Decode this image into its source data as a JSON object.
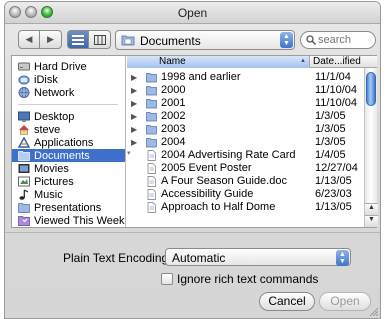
{
  "window": {
    "title": "Open"
  },
  "toolbar": {
    "back_label": "◀",
    "forward_label": "▶",
    "path": "Documents",
    "search_placeholder": "search"
  },
  "sidebar": {
    "devices": [
      {
        "label": "Hard Drive",
        "icon": "hard-drive-icon"
      },
      {
        "label": "iDisk",
        "icon": "idisk-icon"
      },
      {
        "label": "Network",
        "icon": "network-icon"
      }
    ],
    "places": [
      {
        "label": "Desktop",
        "icon": "desktop-icon"
      },
      {
        "label": "steve",
        "icon": "home-icon"
      },
      {
        "label": "Applications",
        "icon": "applications-icon"
      },
      {
        "label": "Documents",
        "icon": "documents-folder-icon",
        "selected": true
      },
      {
        "label": "Movies",
        "icon": "movies-icon"
      },
      {
        "label": "Pictures",
        "icon": "pictures-icon"
      },
      {
        "label": "Music",
        "icon": "music-icon"
      },
      {
        "label": "Presentations",
        "icon": "folder-icon"
      },
      {
        "label": "Viewed This Week",
        "icon": "smart-folder-icon"
      }
    ]
  },
  "file_list": {
    "columns": {
      "name": "Name",
      "date": "Date...ified"
    },
    "rows": [
      {
        "name": "1998 and earlier",
        "date": "11/1/04",
        "type": "folder"
      },
      {
        "name": "2000",
        "date": "11/10/04",
        "type": "folder"
      },
      {
        "name": "2001",
        "date": "11/10/04",
        "type": "folder"
      },
      {
        "name": "2002",
        "date": "1/3/05",
        "type": "folder"
      },
      {
        "name": "2003",
        "date": "1/3/05",
        "type": "folder"
      },
      {
        "name": "2004",
        "date": "1/3/05",
        "type": "folder"
      },
      {
        "name": "2004 Advertising Rate Card",
        "date": "1/4/05",
        "type": "document"
      },
      {
        "name": "2005 Event Poster",
        "date": "12/27/04",
        "type": "document"
      },
      {
        "name": "A Four Season Guide.doc",
        "date": "1/13/05",
        "type": "document"
      },
      {
        "name": "Accessibility Guide",
        "date": "6/23/03",
        "type": "document"
      },
      {
        "name": "Approach to Half Dome",
        "date": "1/13/05",
        "type": "document"
      }
    ]
  },
  "options": {
    "encoding_label": "Plain Text Encoding:",
    "encoding_value": "Automatic",
    "ignore_rich_text_label": "Ignore rich text commands"
  },
  "buttons": {
    "cancel": "Cancel",
    "open": "Open"
  },
  "colors": {
    "selection": "#3d6fcb",
    "accent": "#3d74c9"
  }
}
